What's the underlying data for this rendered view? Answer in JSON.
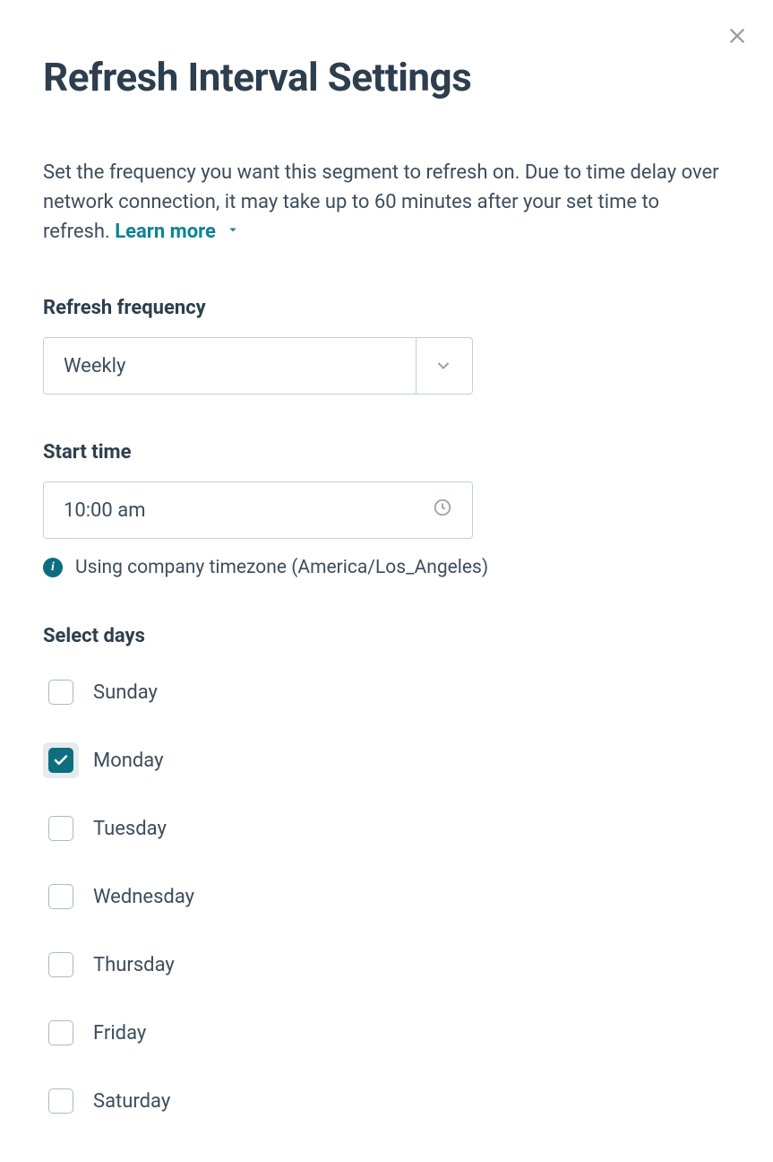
{
  "title": "Refresh Interval Settings",
  "description": "Set the frequency you want this segment to refresh on. Due to time delay over network connection, it may take up to 60 minutes after your set time to refresh.",
  "learn_more_label": "Learn more",
  "frequency": {
    "label": "Refresh frequency",
    "value": "Weekly"
  },
  "start_time": {
    "label": "Start time",
    "value": "10:00 am"
  },
  "timezone_note": "Using company timezone (America/Los_Angeles)",
  "select_days": {
    "label": "Select days",
    "days": [
      {
        "name": "Sunday",
        "checked": false,
        "focused": false
      },
      {
        "name": "Monday",
        "checked": true,
        "focused": true
      },
      {
        "name": "Tuesday",
        "checked": false,
        "focused": false
      },
      {
        "name": "Wednesday",
        "checked": false,
        "focused": false
      },
      {
        "name": "Thursday",
        "checked": false,
        "focused": false
      },
      {
        "name": "Friday",
        "checked": false,
        "focused": false
      },
      {
        "name": "Saturday",
        "checked": false,
        "focused": false
      }
    ]
  }
}
